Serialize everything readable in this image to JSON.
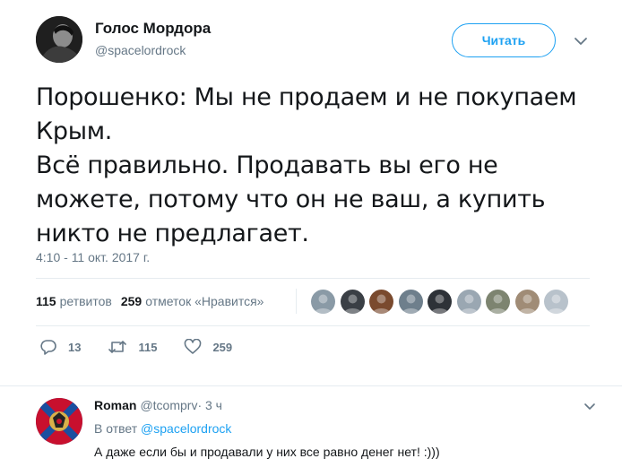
{
  "tweet": {
    "author_name": "Голос Мордора",
    "author_handle": "@spacelordrock",
    "follow_label": "Читать",
    "text_lines": [
      "Порошенко: Мы не продаем и не покупаем Крым.",
      "Всё правильно. Продавать вы его не можете, потому что он не ваш, а купить никто не предлагает."
    ],
    "timestamp": "4:10 - 11 окт. 2017 г.",
    "retweets_count": "115",
    "retweets_label": "ретвитов",
    "likes_count": "259",
    "likes_label": "отметок «Нравится»",
    "liker_avatars": [
      "#8a9aa6",
      "#3a3f45",
      "#7a4a2e",
      "#6e7f8c",
      "#2e3238",
      "#9aa7b2",
      "#7d8470",
      "#a08c76",
      "#b8c2cb"
    ],
    "actions": {
      "reply_count": "13",
      "retweet_count": "115",
      "like_count": "259"
    }
  },
  "reply": {
    "name": "Roman",
    "handle": "@tcomprv",
    "time": "· 3 ч",
    "in_reply_prefix": "В ответ",
    "in_reply_handle": "@spacelordrock",
    "text": "А даже если бы и продавали у них все равно денег нет! :)))"
  },
  "colors": {
    "accent": "#1da1f2",
    "secondary_text": "#657786",
    "border": "#e6ecf0"
  }
}
